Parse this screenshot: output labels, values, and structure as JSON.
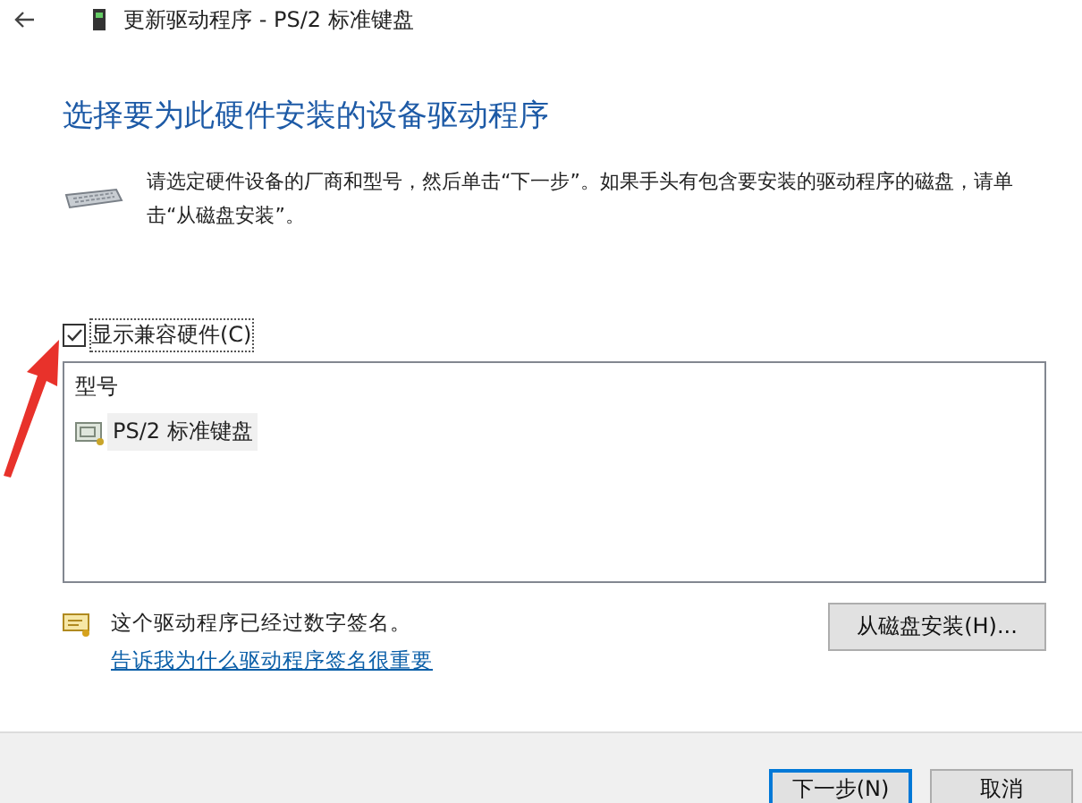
{
  "window": {
    "title": "更新驱动程序 - PS/2 标准键盘"
  },
  "heading": "选择要为此硬件安装的设备驱动程序",
  "description": "请选定硬件设备的厂商和型号，然后单击“下一步”。如果手头有包含要安装的驱动程序的磁盘，请单击“从磁盘安装”。",
  "show_compatible": {
    "label": "显示兼容硬件(C)",
    "checked": true
  },
  "model_list": {
    "header": "型号",
    "items": [
      {
        "label": "PS/2 标准键盘",
        "selected": true
      }
    ]
  },
  "signature": {
    "text": "这个驱动程序已经过数字签名。",
    "link": "告诉我为什么驱动程序签名很重要"
  },
  "have_disk_button": "从磁盘安装(H)...",
  "buttons": [
    {
      "label": "下一步(N)",
      "kind": "default"
    },
    {
      "label": "取消",
      "kind": "normal"
    }
  ]
}
